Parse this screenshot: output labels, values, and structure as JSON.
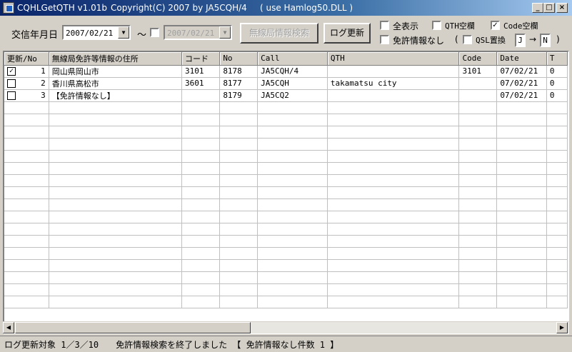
{
  "window": {
    "title_app": "CQHLGetQTH v1.01b",
    "title_copyright": "Copyright(C) 2007  by  JA5CQH/4",
    "title_dll": "( use Hamlog50.DLL )",
    "minimize": "_",
    "maximize": "□",
    "close": "×"
  },
  "toolbar": {
    "date_label": "交信年月日",
    "date_from": "2007/02/21",
    "tilde": "〜",
    "date_to": "2007/02/21",
    "search_button": "無線局情報検索",
    "update_button": "ログ更新",
    "show_all": "全表示",
    "qth_blank": "QTH空欄",
    "code_blank": "Code空欄",
    "no_license": "免許情報なし",
    "paren_open": "(",
    "qsl_replace": "QSL置換",
    "qsl_from": "J",
    "arrow": "→",
    "qsl_to": "N",
    "paren_close": ")",
    "checks": {
      "show_all": false,
      "qth_blank": false,
      "code_blank": true,
      "no_license": false,
      "qsl_replace": false,
      "date_to_enabled": false
    }
  },
  "table": {
    "columns": [
      "更新/No",
      "無線局免許等情報の住所",
      "コード",
      "No",
      "Call",
      "QTH",
      "Code",
      "Date",
      "T"
    ],
    "rows": [
      {
        "checked": true,
        "no": "1",
        "address": "岡山県岡山市",
        "code": "3101",
        "num": "8178",
        "call": "JA5CQH/4",
        "qth": "",
        "code2": "3101",
        "date": "07/02/21",
        "t": "0"
      },
      {
        "checked": false,
        "no": "2",
        "address": "香川県高松市",
        "code": "3601",
        "num": "8177",
        "call": "JA5CQH",
        "qth": "takamatsu city",
        "code2": "",
        "date": "07/02/21",
        "t": "0"
      },
      {
        "checked": false,
        "no": "3",
        "address": "【免許情報なし】",
        "code": "",
        "num": "8179",
        "call": "JA5CQ2",
        "qth": "",
        "code2": "",
        "date": "07/02/21",
        "t": "0"
      }
    ]
  },
  "status": {
    "text": "ログ更新対象 1／3／10　　免許情報検索を終了しました 【 免許情報なし件数 1 】"
  }
}
